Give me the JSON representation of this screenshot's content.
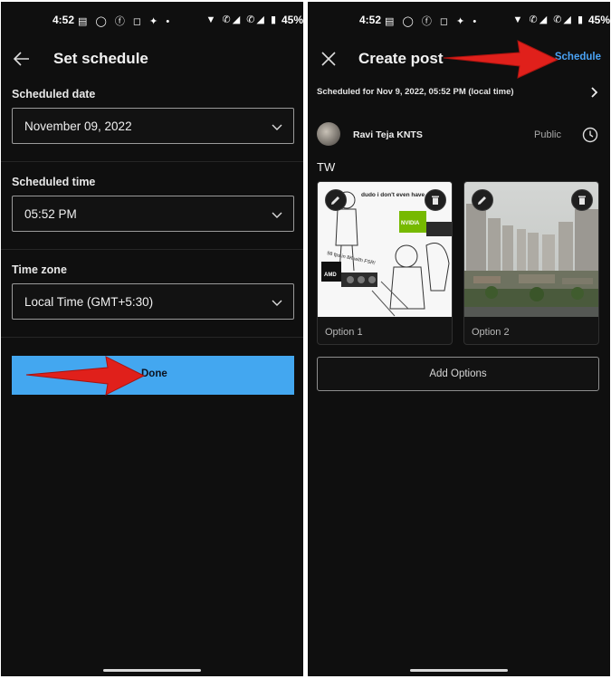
{
  "status_bar": {
    "time": "4:52",
    "battery": "45%",
    "left_icons": [
      "news-icon",
      "whatsapp-icon",
      "facebook-icon",
      "instagram-icon",
      "twitter-icon",
      "dot-icon"
    ],
    "right_icons": [
      "wifi-icon",
      "wifi-call-icon",
      "signal-icon",
      "wifi-call-icon",
      "signal-icon",
      "battery-icon"
    ]
  },
  "set_schedule": {
    "title": "Set schedule",
    "back_icon": "back-arrow-icon",
    "date_label": "Scheduled date",
    "date_value": "November 09, 2022",
    "time_label": "Scheduled time",
    "time_value": "05:52 PM",
    "tz_label": "Time zone",
    "tz_value": "Local Time (GMT+5:30)",
    "done_label": "Done"
  },
  "create_post": {
    "title": "Create post",
    "close_icon": "close-icon",
    "schedule_label": "Schedule",
    "scheduled_for": "Scheduled for Nov 9, 2022, 05:52 PM (local time)",
    "author": "Ravi Teja KNTS",
    "visibility": "Public",
    "post_text": "TW",
    "options": [
      {
        "label": "Option 1",
        "meme_text_top": "dudo i don't even have 4K yet",
        "meme_text_bottom": "98 fps in 8K with FSR!",
        "brand_1": "NVIDIA",
        "brand_2": "AMD"
      },
      {
        "label": "Option 2"
      }
    ],
    "add_options_label": "Add Options"
  },
  "colors": {
    "background": "#0f0f0f",
    "accent_blue": "#43a7f0",
    "link_blue": "#4aa3f5",
    "annotation_red": "#e0201b",
    "field_border": "#9a9a9a"
  }
}
